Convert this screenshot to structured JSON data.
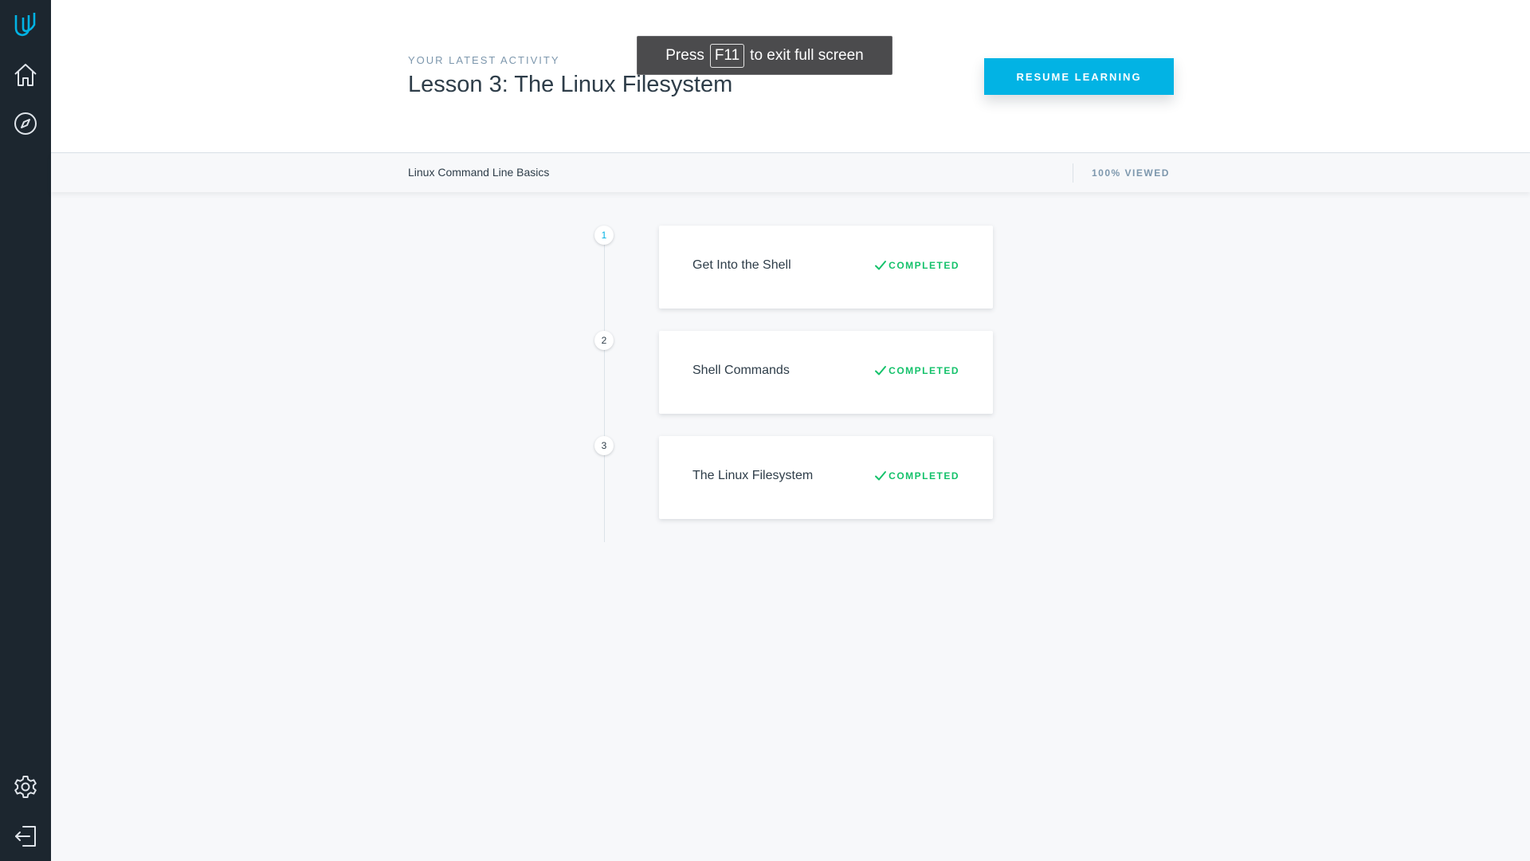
{
  "sidebar": {
    "icons": [
      "udacity-logo-icon",
      "home-icon",
      "compass-icon",
      "gear-icon",
      "logout-icon"
    ]
  },
  "header": {
    "eyebrow": "YOUR LATEST ACTIVITY",
    "title": "Lesson 3: The Linux Filesystem",
    "resume_label": "RESUME LEARNING"
  },
  "fullscreen_toast": {
    "before": "Press",
    "key": "F11",
    "after": "to exit full screen"
  },
  "subbar": {
    "course_name": "Linux Command Line Basics",
    "progress_label": "100% VIEWED",
    "progress_fraction": 1.0
  },
  "lessons": [
    {
      "number": "1",
      "title": "Get Into the Shell",
      "status": "COMPLETED"
    },
    {
      "number": "2",
      "title": "Shell Commands",
      "status": "COMPLETED"
    },
    {
      "number": "3",
      "title": "The Linux Filesystem",
      "status": "COMPLETED"
    }
  ],
  "colors": {
    "sidebar_bg": "#1c262f",
    "accent": "#02b3e4",
    "completed": "#15c26b",
    "text_primary": "#2e3d49",
    "text_muted": "#7d97ad"
  }
}
